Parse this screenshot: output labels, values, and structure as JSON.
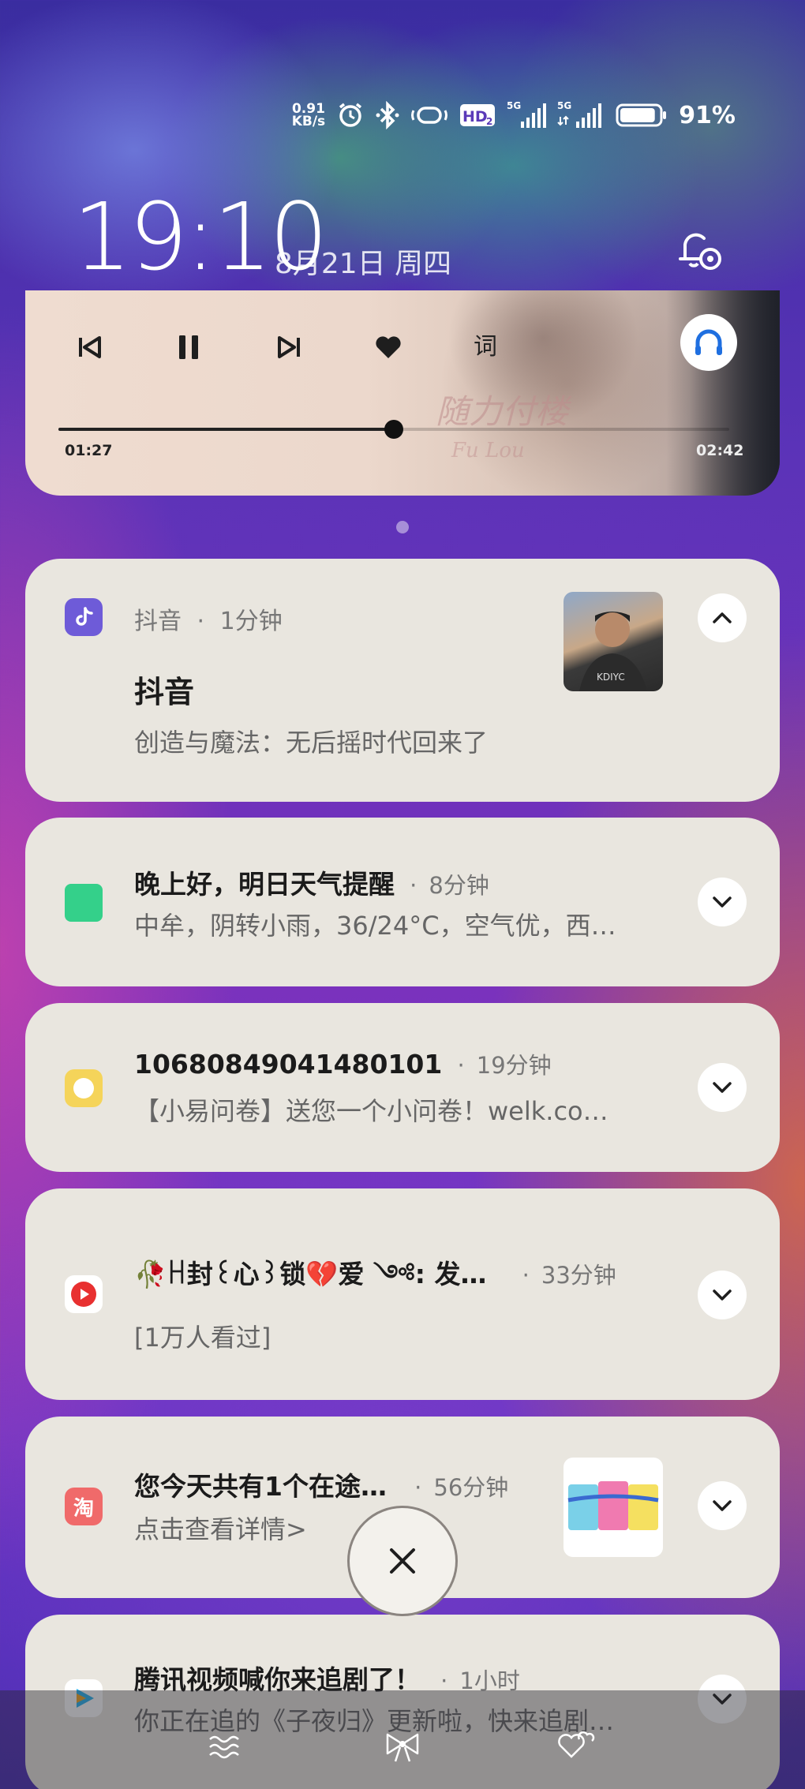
{
  "status_bar": {
    "net_speed_value": "0.91",
    "net_speed_unit": "KB/s",
    "hd_label": "HD",
    "hd_sub": "2",
    "sim1_type": "5G",
    "sim2_type": "5G",
    "battery_percent": "91%",
    "battery_level": 0.91,
    "icons": [
      "alarm-icon",
      "bluetooth-icon",
      "vibrate-icon",
      "hd-voice-icon",
      "signal-icon",
      "signal-icon",
      "battery-icon"
    ]
  },
  "lockscreen": {
    "time": "19:10",
    "date": "8月21日 周四"
  },
  "music": {
    "lyrics_label": "词",
    "elapsed": "01:27",
    "total": "02:42",
    "progress": 0.5,
    "album_text_1": "随力付楼",
    "album_text_2": "Fu Lou",
    "accent": "#1f6fe0"
  },
  "notifications": [
    {
      "app": "抖音",
      "time": "1分钟",
      "title": "抖音",
      "body": "创造与魔法：无后摇时代回来了",
      "icon": "douyin-icon",
      "icon_color": "#6e5bd8",
      "expanded": true
    },
    {
      "title": "晚上好，明日天气提醒",
      "time": "8分钟",
      "body": "中牟，阴转小雨，36/24°C，空气优，西…",
      "icon": "weather-icon",
      "icon_color": "#34d08a"
    },
    {
      "title": "10680849041480101",
      "time": "19分钟",
      "body": "【小易问卷】送您一个小问卷！welk.co…",
      "icon": "message-icon",
      "icon_color": "#f5d45a"
    },
    {
      "title": "🥀ꀿ封꒰心꒱锁💔爱 ༺: 发…",
      "time": "33分钟",
      "body": "[1万人看过]",
      "icon": "video-play-icon",
      "icon_color": "#e83030"
    },
    {
      "title": "您今天共有1个在途…",
      "time": "56分钟",
      "body": "点击查看详情>",
      "icon": "taobao-icon",
      "icon_label": "淘",
      "icon_color": "#f06a6a"
    },
    {
      "title": "腾讯视频喊你来追剧了！",
      "time": "1小时",
      "body": "你正在追的《子夜归》更新啦，快来追剧…",
      "icon": "tencent-video-icon",
      "icon_color": "#2ab4f0"
    }
  ],
  "separator": "·"
}
